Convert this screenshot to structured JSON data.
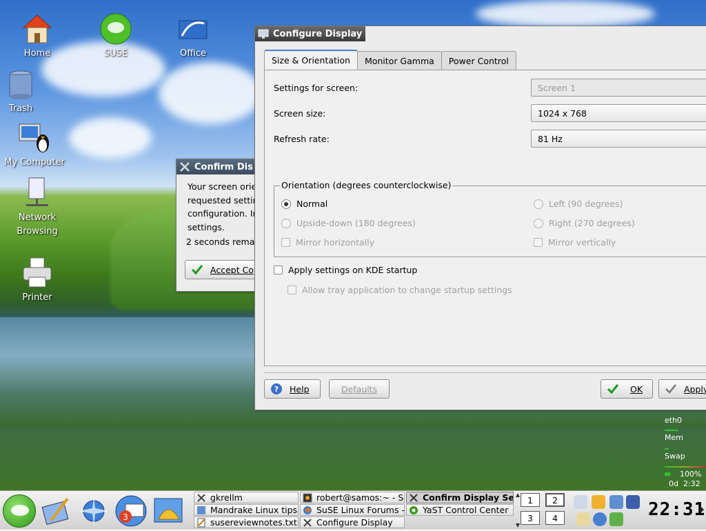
{
  "desktop": {
    "icons": [
      {
        "label": "Home"
      },
      {
        "label": "SUSE"
      },
      {
        "label": "Office"
      },
      {
        "label": "Trash"
      },
      {
        "label": "My Computer"
      },
      {
        "label": "Network Browsing"
      },
      {
        "label": "Printer"
      }
    ]
  },
  "confirm_dialog": {
    "title": "Confirm Dis",
    "message_lines": [
      "Your screen orie",
      "requested settin",
      "configuration. In",
      "settings."
    ],
    "countdown": "2 seconds remai",
    "accept_label": "Accept Co"
  },
  "config_window": {
    "title": "Configure Display",
    "tabs": [
      "Size & Orientation",
      "Monitor Gamma",
      "Power Control"
    ],
    "settings_for_screen_label": "Settings for screen:",
    "screen_value": "Screen 1",
    "screen_size_label": "Screen size:",
    "screen_size_value": "1024 x 768",
    "refresh_rate_label": "Refresh rate:",
    "refresh_rate_value": "81 Hz",
    "orientation_title": "Orientation (degrees counterclockwise)",
    "orientation": {
      "normal": "Normal",
      "upside_down": "Upside-down (180 degrees)",
      "mirror_h": "Mirror horizontally",
      "left": "Left (90 degrees)",
      "right": "Right (270 degrees)",
      "mirror_v": "Mirror vertically"
    },
    "apply_on_startup": "Apply settings on KDE startup",
    "allow_tray": "Allow tray application to change startup settings",
    "buttons": {
      "help": "Help",
      "defaults": "Defaults",
      "ok": "OK",
      "apply": "Apply"
    }
  },
  "monitor": {
    "eth": "eth0",
    "mem": "Mem",
    "swap": "Swap",
    "battery": "100%",
    "uptime": "0d  2:32"
  },
  "taskbar": {
    "tasks_col1": [
      "gkrellm",
      "Mandrake Linux tips",
      "susereviewnotes.txt"
    ],
    "tasks_col2": [
      "robert@samos:~ - Sh",
      "SuSE Linux Forums -",
      "Configure Display"
    ],
    "tasks_col3": [
      "Confirm Display Se",
      "YaST Control Center"
    ],
    "desktops": [
      "1",
      "2",
      "3",
      "4"
    ],
    "clock": "22:31"
  },
  "colors": {
    "ok_check": "#1a9a1a",
    "title_active": "#3a3a3a",
    "accent_tab": "#4a7ec9"
  }
}
